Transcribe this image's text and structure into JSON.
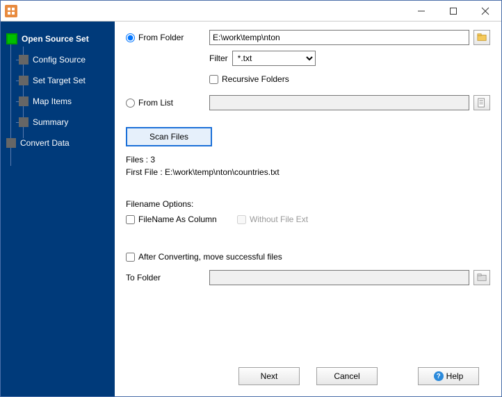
{
  "sidebar": {
    "items": [
      {
        "label": "Open Source Set"
      },
      {
        "label": "Config Source"
      },
      {
        "label": "Set Target Set"
      },
      {
        "label": "Map Items"
      },
      {
        "label": "Summary"
      },
      {
        "label": "Convert Data"
      }
    ]
  },
  "form": {
    "from_folder_label": "From Folder",
    "from_folder_value": "E:\\work\\temp\\nton",
    "filter_label": "Filter",
    "filter_value": "*.txt",
    "recursive_label": "Recursive Folders",
    "from_list_label": "From List",
    "from_list_value": "",
    "scan_label": "Scan Files",
    "files_count": "Files : 3",
    "first_file": "First File : E:\\work\\temp\\nton\\countries.txt",
    "filename_options": "Filename Options:",
    "filename_as_column": "FileName As Column",
    "without_ext": "Without File Ext",
    "after_converting": "After Converting, move successful files",
    "to_folder_label": "To Folder",
    "to_folder_value": ""
  },
  "buttons": {
    "next": "Next",
    "cancel": "Cancel",
    "help": "Help"
  }
}
